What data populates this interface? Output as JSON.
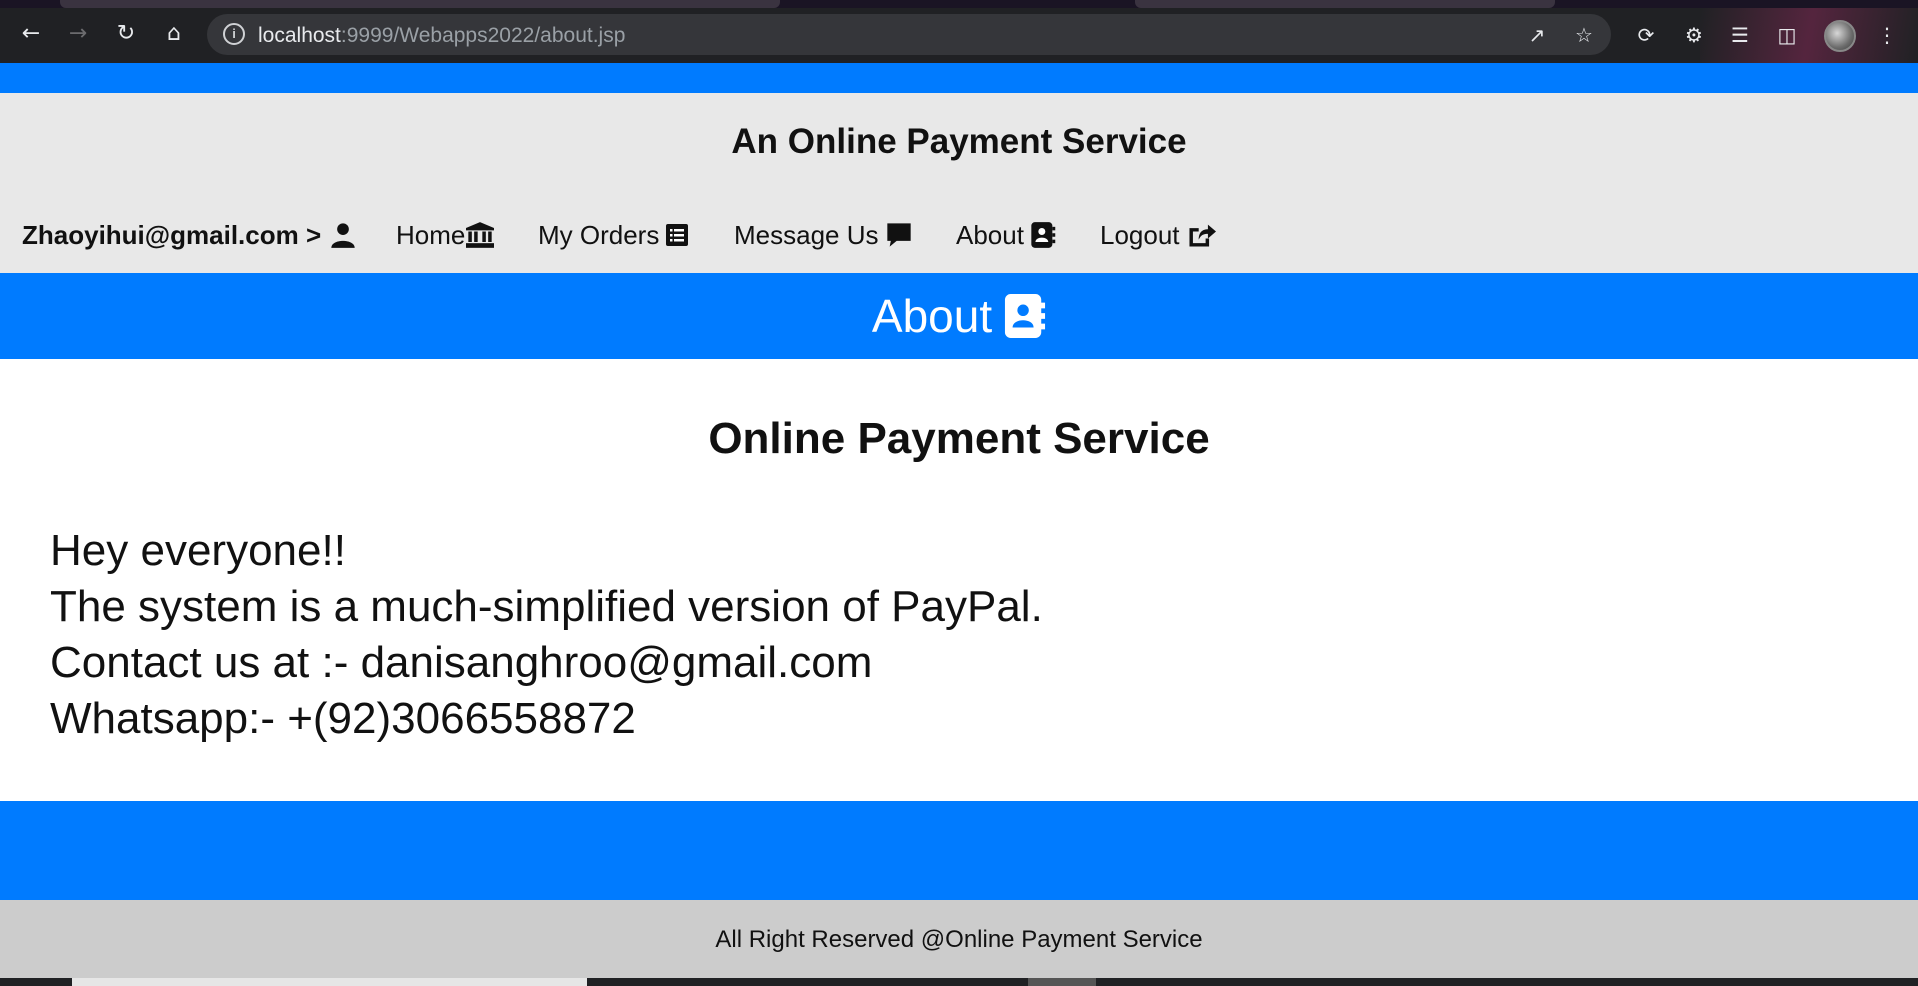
{
  "browser": {
    "url_host": "localhost",
    "url_path": ":9999/Webapps2022/about.jsp"
  },
  "header": {
    "site_title": "An Online Payment Service",
    "nav": {
      "user_label": "Zhaoyihui@gmail.com >",
      "home": "Home",
      "orders": "My Orders",
      "message": "Message Us",
      "about": "About",
      "logout": "Logout"
    }
  },
  "banner": {
    "title": "About"
  },
  "content": {
    "title": "Online Payment Service",
    "lines": [
      "Hey everyone!!",
      "The system is a much-simplified version of PayPal.",
      "Contact us at :- danisanghroo@gmail.com",
      "Whatsapp:- +(92)3066558872"
    ]
  },
  "footer": {
    "text": "All Right Reserved @Online Payment Service"
  },
  "colors": {
    "primary_blue": "#007bff",
    "header_gray": "#e8e8e8",
    "footer_gray": "#cccccc"
  }
}
